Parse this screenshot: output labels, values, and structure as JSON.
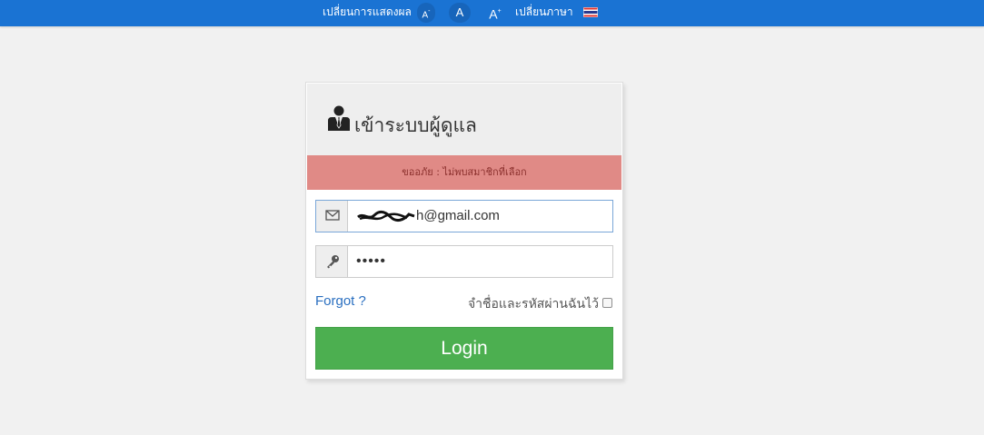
{
  "topbar": {
    "display_label": "เปลี่ยนการแสดงผล",
    "font_small": "A",
    "font_small_sup": "-",
    "font_normal": "A",
    "font_large": "A",
    "font_large_sup": "+",
    "language_label": "เปลี่ยนภาษา",
    "flag_icon": "thai-flag-icon"
  },
  "login": {
    "title": "เข้าระบบผู้ดูแล",
    "title_icon": "user-suit-icon",
    "alert": "ขออภัย : ไม่พบสมาชิกที่เลือก",
    "email_icon": "envelope-icon",
    "email_value": "h@gmail.com",
    "password_icon": "key-icon",
    "password_value": "•••••",
    "forgot_label": "Forgot ?",
    "remember_label": "จำชื่อและรหัสผ่านฉันไว้",
    "remember_checked": false,
    "login_label": "Login"
  },
  "colors": {
    "topbar": "#1a73d3",
    "alert_bg": "#e08a86",
    "login_button": "#4caf50",
    "link": "#2a6fc0"
  }
}
